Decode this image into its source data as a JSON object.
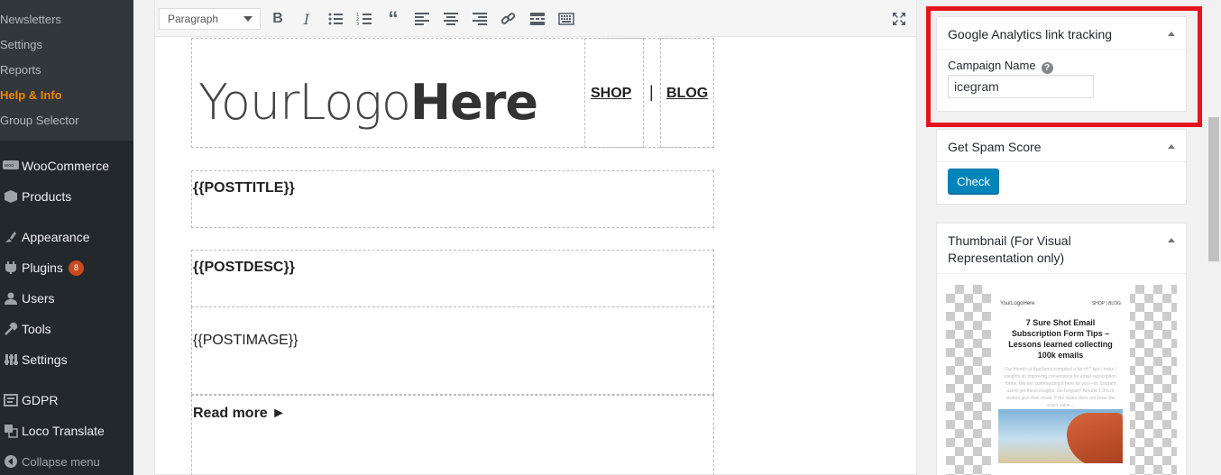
{
  "sidebar": {
    "submenu": [
      "Newsletters",
      "Settings",
      "Reports",
      "Help & Info",
      "Group Selector"
    ],
    "current_submenu": "Help & Info",
    "menu": [
      {
        "label": "WooCommerce",
        "icon": "woocommerce-icon"
      },
      {
        "label": "Products",
        "icon": "products-icon"
      },
      {
        "label": "Appearance",
        "icon": "appearance-icon"
      },
      {
        "label": "Plugins",
        "icon": "plugins-icon",
        "badge": "8"
      },
      {
        "label": "Users",
        "icon": "users-icon"
      },
      {
        "label": "Tools",
        "icon": "tools-icon"
      },
      {
        "label": "Settings",
        "icon": "settings-icon"
      },
      {
        "label": "GDPR",
        "icon": "gdpr-icon"
      },
      {
        "label": "Loco Translate",
        "icon": "loco-translate-icon"
      }
    ],
    "collapse_label": "Collapse menu"
  },
  "editor": {
    "format_value": "Paragraph",
    "logo_light": "YourLogo",
    "logo_bold": "Here",
    "nav_shop": "SHOP",
    "nav_separator": "|",
    "nav_blog": "BLOG",
    "post_title": "{{POSTTITLE}}",
    "post_desc": "{{POSTDESC}}",
    "post_image": "{{POSTIMAGE}}",
    "read_more": "Read more ►"
  },
  "metaboxes": {
    "analytics": {
      "title": "Google Analytics link tracking",
      "campaign_label": "Campaign Name",
      "campaign_value": "icegram"
    },
    "spam": {
      "title": "Get Spam Score",
      "check_label": "Check"
    },
    "thumbnail": {
      "title_line1": "Thumbnail (For Visual",
      "title_line2": "Representation only)",
      "preview_logo": "YourLogoHere",
      "preview_nav": "SHOP  |  BLOG",
      "preview_title": "7 Sure Shot Email Subscription Form Tips – Lessons learned collecting 100k emails",
      "preview_body": "Our friends at AppSumo compiled a list of 7 tips / tricks / insights on improving conversions for email subscription forms. We are summarizing it here for you—so Icegram users get these insights. Go Icegram! Around 1-3% of visitors give their email. If the visitor does not know the exact value..."
    }
  },
  "colors": {
    "sidebar_bg": "#23282d",
    "submenu_bg": "#32373c",
    "current_submenu": "#f18500",
    "primary_button": "#0085ba",
    "highlight_border": "#e5151e",
    "plugins_badge": "#ca4a1f"
  }
}
